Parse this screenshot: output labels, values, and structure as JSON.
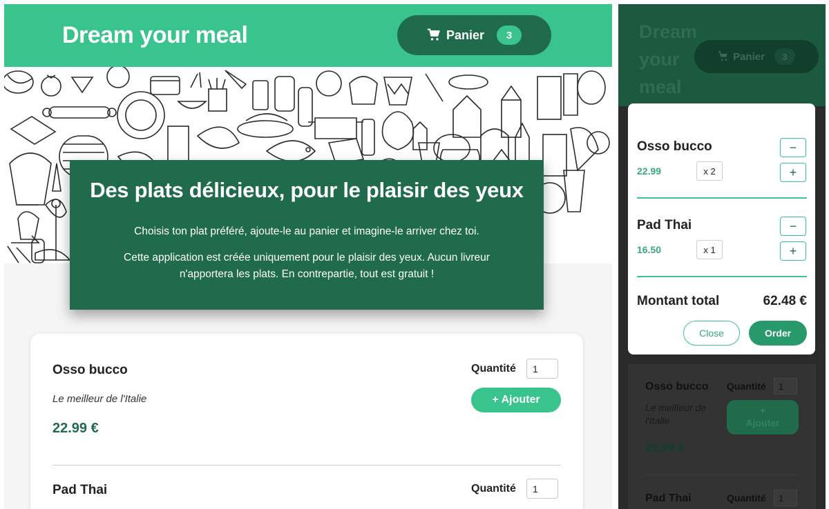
{
  "desktop": {
    "header": {
      "brand": "Dream your meal",
      "cart_label": "Panier",
      "cart_count": "3",
      "cart_icon": "cart-icon"
    },
    "hero": {
      "title": "Des plats délicieux, pour le plaisir des yeux",
      "paragraph1": "Choisis ton plat préféré, ajoute-le au panier et imagine-le arriver chez toi.",
      "paragraph2": "Cette application est créée uniquement pour le plaisir des yeux. Aucun livreur n'apportera les plats. En contrepartie, tout est gratuit !"
    },
    "menu": [
      {
        "name": "Osso bucco",
        "description": "Le meilleur de l'Italie",
        "price": "22.99 €",
        "quantity_label": "Quantité",
        "quantity_value": "1",
        "add_label": "+ Ajouter"
      },
      {
        "name": "Pad Thai",
        "quantity_label": "Quantité",
        "quantity_value": "1"
      }
    ]
  },
  "mobile": {
    "header": {
      "brand": "Dream your meal",
      "cart_label": "Panier",
      "cart_count": "3"
    },
    "cart_modal": {
      "items": [
        {
          "name": "Osso bucco",
          "price": "22.99",
          "multiplier": "x 2",
          "minus": "−",
          "plus": "+"
        },
        {
          "name": "Pad Thai",
          "price": "16.50",
          "multiplier": "x 1",
          "minus": "−",
          "plus": "+"
        }
      ],
      "total_label": "Montant total",
      "total_value": "62.48 €",
      "close_label": "Close",
      "order_label": "Order"
    },
    "menu": [
      {
        "name": "Osso bucco",
        "quantity_label": "Quantité",
        "quantity_value": "1",
        "description": "Le meilleur de l'Italie",
        "add_plus": "+",
        "add_label": "Ajouter",
        "price": "22.99 €"
      },
      {
        "name": "Pad Thai",
        "quantity_label": "Quantité",
        "quantity_value": "1"
      }
    ]
  },
  "colors": {
    "brand_green": "#39c48d",
    "dark_green": "#1f6b4c",
    "price_green": "#1f6b4c"
  }
}
